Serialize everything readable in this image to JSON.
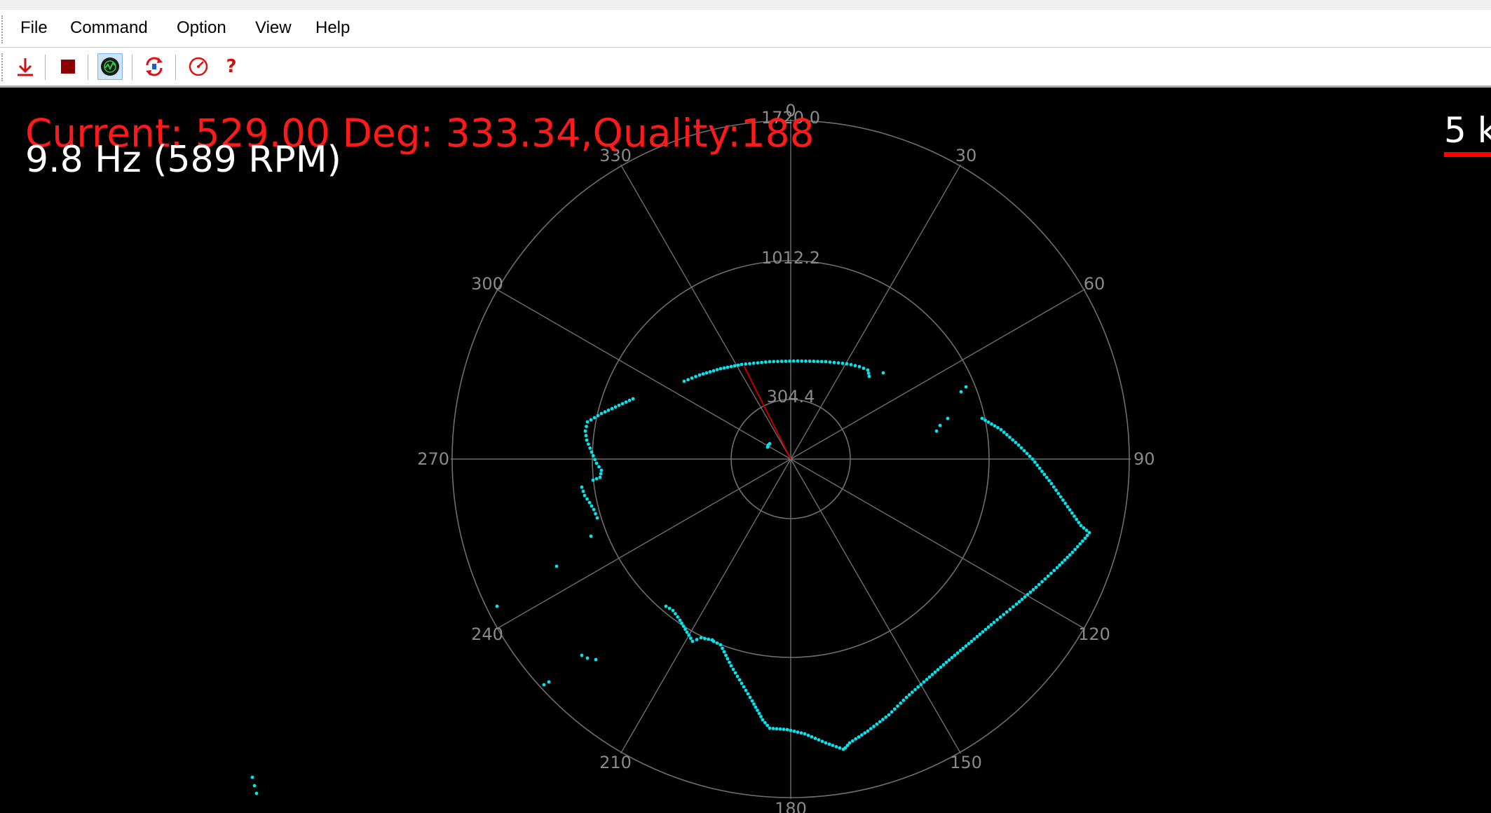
{
  "menu": {
    "items": [
      {
        "name": "menu-file",
        "label": "File"
      },
      {
        "name": "menu-command",
        "label": "Command"
      },
      {
        "name": "menu-option",
        "label": "Option"
      },
      {
        "name": "menu-view",
        "label": "View"
      },
      {
        "name": "menu-help",
        "label": "Help"
      }
    ]
  },
  "toolbar": {
    "buttons": [
      {
        "name": "download-icon",
        "color": "#d01010"
      },
      {
        "name": "stop-icon",
        "color": "#8b0000"
      },
      {
        "name": "radar-scan-icon",
        "color": "#1a1a1a",
        "active": true
      },
      {
        "name": "refresh-icon",
        "color": "#e01010"
      },
      {
        "name": "gauge-icon",
        "color": "#e01010"
      },
      {
        "name": "help-icon",
        "label": "?",
        "color": "#d01010"
      }
    ]
  },
  "status": {
    "current_text": "Current: 529.00 Deg: 333.34,Quality:188",
    "frequency_text": "9.8 Hz (589 RPM)"
  },
  "scale": {
    "label": "5 k",
    "color": "#ff0000"
  },
  "polar": {
    "range_labels": [
      "304.4",
      "1012.2",
      "1720.0"
    ],
    "angle_labels": [
      "0",
      "30",
      "60",
      "90",
      "120",
      "150",
      "180",
      "210",
      "240",
      "270",
      "300",
      "330"
    ],
    "current_angle_deg": 333.34,
    "current_distance": 529.0,
    "grid_color": "#6e6e6e",
    "label_color": "#8a8a8a",
    "point_color": "#00e5ee",
    "beam_color": "#c00000"
  }
}
